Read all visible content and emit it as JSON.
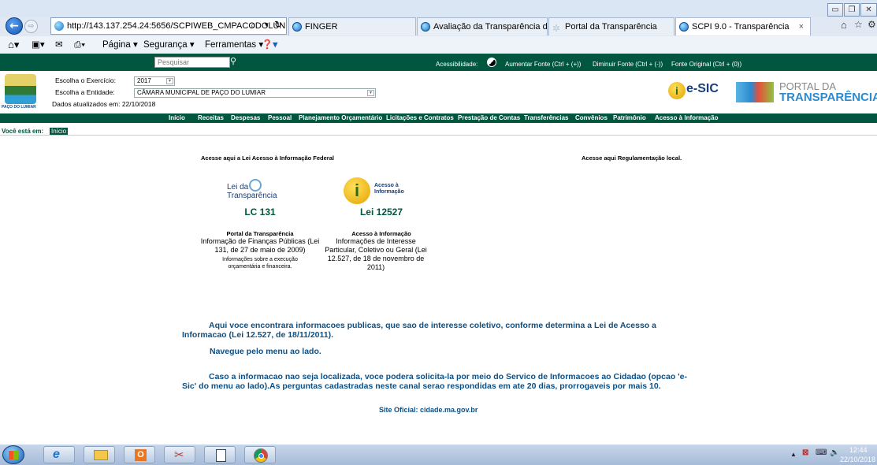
{
  "browser": {
    "address": "http://143.137.254.24:5656/SCPIWEB_CMPACODOLUN",
    "address_host": "143.137.254.24",
    "tabs": [
      {
        "label": "FINGER"
      },
      {
        "label": "Avaliação da Transparência do..."
      },
      {
        "label": "Portal da Transparência"
      },
      {
        "label": "SCPI 9.0 - Transparência"
      }
    ],
    "active_tab_close": "×",
    "commands": {
      "page": "Página",
      "security": "Segurança",
      "tools": "Ferramentas"
    }
  },
  "site": {
    "search_placeholder": "Pesquisar",
    "accessibility": {
      "label": "Acessibilidade:",
      "increase": "Aumentar Fonte (Ctrl + (+))",
      "decrease": "Diminuir Fonte (Ctrl + (-))",
      "original": "Fonte Original (Ctrl + (0))"
    },
    "logo_caption": "PAÇO DO LUMIAR",
    "exercise_label": "Escolha o Exercício:",
    "exercise_value": "2017",
    "entity_label": "Escolha a Entidade:",
    "entity_value": "CÂMARA MUNICIPAL DE PAÇO DO LUMIAR",
    "updated_label": "Dados atualizados em: 22/10/2018",
    "esic_label": "e-SIC",
    "portal_line1": "PORTAL DA",
    "portal_line2": "TRANSPARÊNCIA",
    "menu": [
      "Início",
      "Receitas",
      "Despesas",
      "Pessoal",
      "Planejamento Orçamentário",
      "Licitações e Contratos",
      "Prestação de Contas",
      "Transferências",
      "Convênios",
      "Patrimônio",
      "Acesso à Informação"
    ],
    "breadcrumb_label": "Você está em:",
    "breadcrumb_current": "Início"
  },
  "content": {
    "federal_heading": "Acesse aqui a Lei Acesso à Informação Federal",
    "local_heading": "Acesse aqui Regulamentação local.",
    "lc131_logo_line1": "Lei da",
    "lc131_logo_line2": "Transparência",
    "lc131_title": "LC 131",
    "lc131_sub": "Portal da Transparência",
    "lc131_desc": "Informação de Finanças Públicas (Lei 131, de 27 de maio de 2009)",
    "lc131_note": "Informações sobre a execução orçamentária e financeira.",
    "lai_logo_line1": "Acesso à",
    "lai_logo_line2": "Informação",
    "lai_title": "Lei 12527",
    "lai_sub": "Acesso à Informação",
    "lai_desc": "Informações de Interesse Particular, Coletivo ou Geral (Lei 12.527, de 18 de novembro de 2011)",
    "para1": "Aqui voce encontrara informacoes publicas, que sao de interesse coletivo, conforme determina a Lei de Acesso a Informacao (Lei 12.527, de 18/11/2011).",
    "para2": "Navegue pelo menu ao lado.",
    "para3": "Caso a informacao nao seja localizada, voce podera solicita-la por meio do Servico de Informacoes ao Cidadao (opcao 'e-Sic' do menu ao lado).As perguntas cadastradas neste canal serao respondidas em ate 20 dias, prorrogaveis por mais 10.",
    "official_site": "Site Oficial: cidade.ma.gov.br"
  },
  "taskbar": {
    "time": "12:44",
    "date": "22/10/2018"
  }
}
